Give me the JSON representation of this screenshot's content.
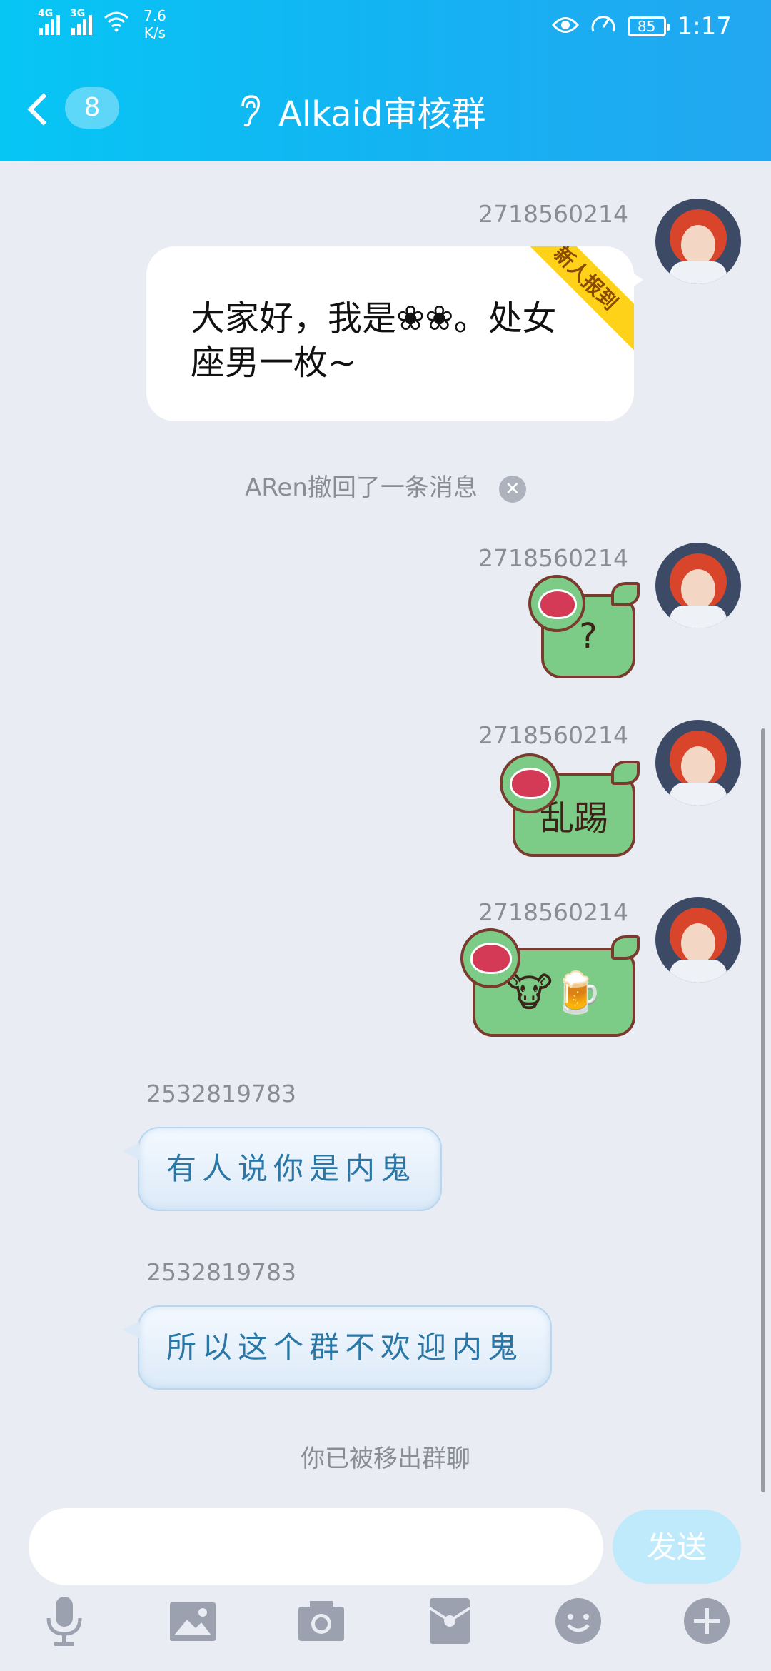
{
  "status_bar": {
    "signal_1": "4G",
    "signal_2": "3G",
    "speed_value": "7.6",
    "speed_unit": "K/s",
    "battery": "85",
    "time": "1:17"
  },
  "header": {
    "unread_count": "8",
    "group_name": "Alkaid审核群"
  },
  "messages": [
    {
      "sender": "2718560214",
      "text": "大家好，我是❀❀。处女座男一枚~",
      "tag": "新人报到"
    },
    {
      "system": "ARen撤回了一条消息"
    },
    {
      "sender": "2718560214",
      "text": "?"
    },
    {
      "sender": "2718560214",
      "text": "乱踢"
    },
    {
      "sender": "2718560214",
      "text": "🐮🍺"
    },
    {
      "sender": "2532819783",
      "text": "有人说你是内鬼"
    },
    {
      "sender": "2532819783",
      "text": "所以这个群不欢迎内鬼"
    },
    {
      "system": "你已被移出群聊"
    }
  ],
  "input": {
    "value": "",
    "send_label": "发送"
  },
  "toolbar_icons": [
    "mic-icon",
    "image-icon",
    "camera-icon",
    "red-packet-icon",
    "emoji-icon",
    "plus-icon"
  ]
}
